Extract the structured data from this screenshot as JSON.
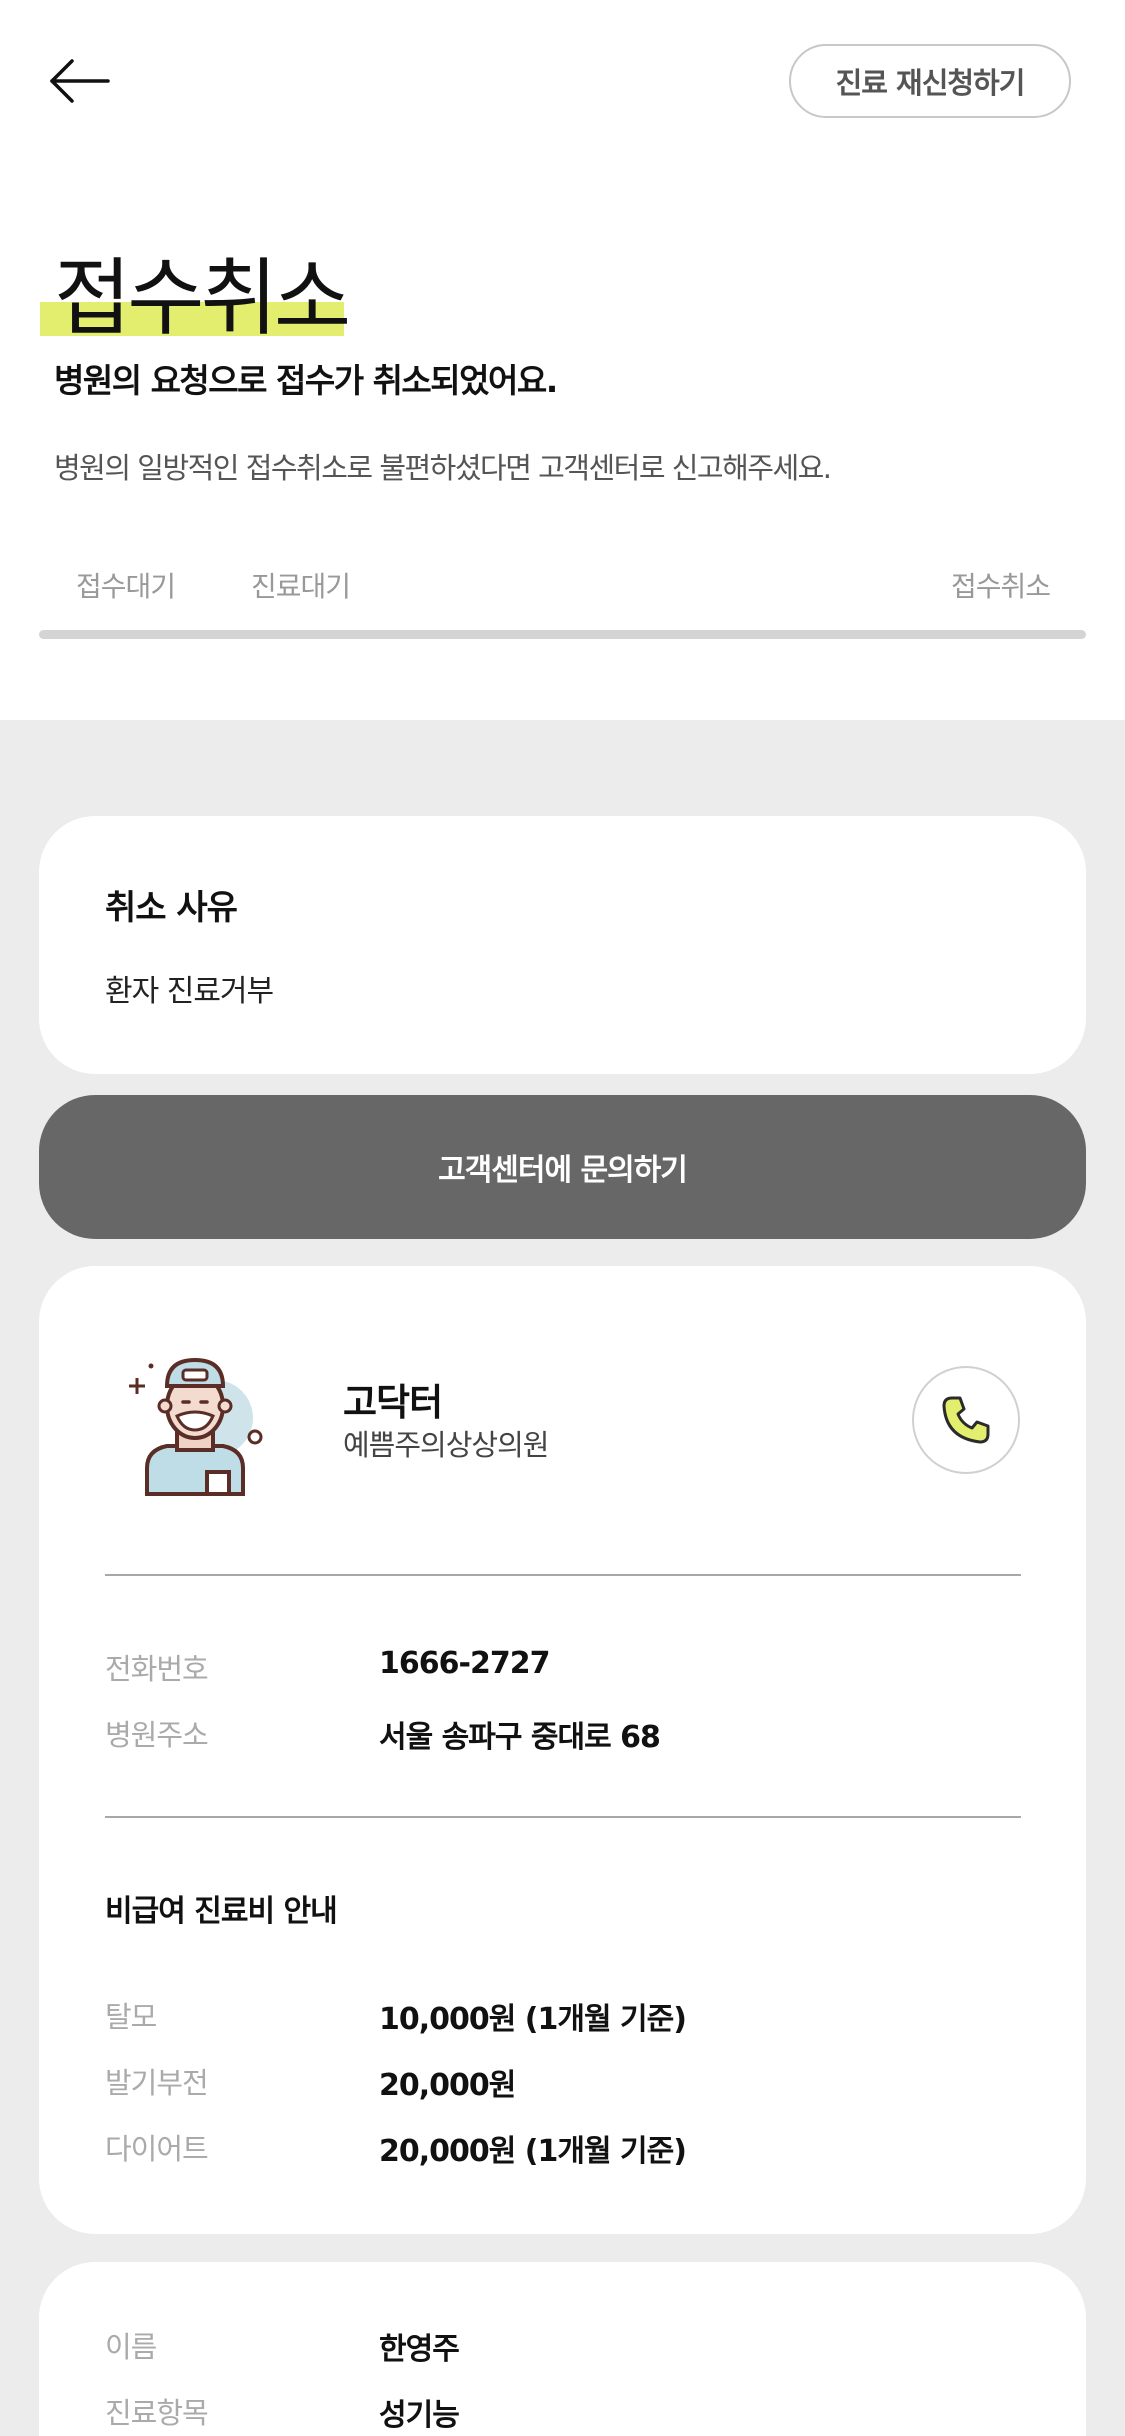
{
  "header": {
    "back_icon": "arrow-left-icon",
    "reapply_label": "진료 재신청하기",
    "title": "접수취소",
    "subtitle": "병원의 요청으로 접수가 취소되었어요.",
    "description": "병원의 일방적인 접수취소로 불편하셨다면 고객센터로 신고해주세요."
  },
  "steps": [
    "접수대기",
    "진료대기",
    "접수취소"
  ],
  "colors": {
    "highlight": "#e3ee6f",
    "button_gray": "#676767",
    "background_gray": "#ececec",
    "phone_icon": "#e3ee6f"
  },
  "reason": {
    "label": "취소 사유",
    "value": "환자 진료거부"
  },
  "contact_button": "고객센터에 문의하기",
  "doctor": {
    "avatar_icon": "doctor-avatar-icon",
    "name": "고닥터",
    "clinic": "예쁨주의상상의원",
    "call_icon": "phone-icon"
  },
  "hospital_info": [
    {
      "label": "전화번호",
      "value": "1666-2727"
    },
    {
      "label": "병원주소",
      "value": "서울 송파구 중대로 68"
    }
  ],
  "fees": {
    "title": "비급여 진료비 안내",
    "items": [
      {
        "label": "탈모",
        "value": "10,000원 (1개월 기준)"
      },
      {
        "label": "발기부전",
        "value": "20,000원"
      },
      {
        "label": "다이어트",
        "value": "20,000원 (1개월 기준)"
      }
    ]
  },
  "patient": [
    {
      "label": "이름",
      "value": "한영주"
    },
    {
      "label": "진료항목",
      "value": "성기능"
    }
  ]
}
